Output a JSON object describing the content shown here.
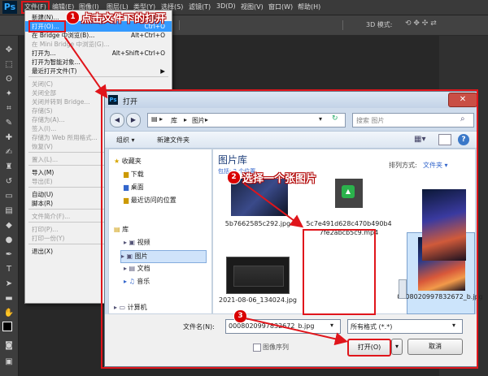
{
  "app": {
    "logo": "Ps"
  },
  "menubar": [
    "文件(F)",
    "编辑(E)",
    "图像(I)",
    "图层(L)",
    "类型(Y)",
    "选择(S)",
    "滤镜(T)",
    "3D(D)",
    "视图(V)",
    "窗口(W)",
    "帮助(H)"
  ],
  "options_bar": {
    "mode_3d": "3D 模式:"
  },
  "file_menu": {
    "items": [
      {
        "label": "新建(N)...",
        "shortcut": "Ctrl+N",
        "disabled": false
      },
      {
        "label": "打开(O)...",
        "shortcut": "Ctrl+O",
        "disabled": false,
        "highlight": true
      },
      {
        "label": "在 Bridge 中浏览(B)...",
        "shortcut": "Alt+Ctrl+O",
        "disabled": false
      },
      {
        "label": "在 Mini Bridge 中浏览(G)...",
        "shortcut": "",
        "disabled": true
      },
      {
        "label": "打开为...",
        "shortcut": "Alt+Shift+Ctrl+O",
        "disabled": false
      },
      {
        "label": "打开为智能对象...",
        "shortcut": "",
        "disabled": false
      },
      {
        "label": "最近打开文件(T)",
        "shortcut": "▶",
        "disabled": false
      },
      {
        "sep": true
      },
      {
        "label": "关闭(C)",
        "shortcut": "",
        "disabled": true
      },
      {
        "label": "关闭全部",
        "shortcut": "",
        "disabled": true
      },
      {
        "label": "关闭并转到 Bridge...",
        "shortcut": "",
        "disabled": true
      },
      {
        "label": "存储(S)",
        "shortcut": "",
        "disabled": true
      },
      {
        "label": "存储为(A)...",
        "shortcut": "",
        "disabled": true
      },
      {
        "label": "签入(I)...",
        "shortcut": "",
        "disabled": true
      },
      {
        "label": "存储为 Web 所用格式...",
        "shortcut": "",
        "disabled": true
      },
      {
        "label": "恢复(V)",
        "shortcut": "",
        "disabled": true
      },
      {
        "sep": true
      },
      {
        "label": "置入(L)...",
        "shortcut": "",
        "disabled": true
      },
      {
        "sep": true
      },
      {
        "label": "导入(M)",
        "shortcut": "",
        "disabled": false
      },
      {
        "label": "导出(E)",
        "shortcut": "",
        "disabled": true
      },
      {
        "sep": true
      },
      {
        "label": "自动(U)",
        "shortcut": "",
        "disabled": false
      },
      {
        "label": "脚本(R)",
        "shortcut": "",
        "disabled": false
      },
      {
        "sep": true
      },
      {
        "label": "文件简介(F)...",
        "shortcut": "",
        "disabled": true
      },
      {
        "sep": true
      },
      {
        "label": "打印(P)...",
        "shortcut": "",
        "disabled": true
      },
      {
        "label": "打印一份(Y)",
        "shortcut": "",
        "disabled": true
      },
      {
        "sep": true
      },
      {
        "label": "退出(X)",
        "shortcut": "",
        "disabled": false
      }
    ]
  },
  "dialog": {
    "title": "打开",
    "breadcrumb": [
      "库",
      "图片"
    ],
    "search_placeholder": "搜索 图片",
    "organize": "组织 ▾",
    "new_folder": "新建文件夹",
    "nav": {
      "favorites": "收藏夹",
      "downloads": "下载",
      "desktop": "桌面",
      "recent": "最近访问的位置",
      "libraries": "库",
      "videos": "视频",
      "pictures": "图片",
      "documents": "文档",
      "music": "音乐",
      "computer": "计算机"
    },
    "library_title": "图片库",
    "library_sub": "包括: 2 个位置",
    "arrange_label": "排列方式:",
    "arrange_value": "文件夹 ▾",
    "files": [
      {
        "name": "5b7662585c292.jpg"
      },
      {
        "name": "5c7e491d628c470b490b47fe2abcb5c9.mp4"
      },
      {
        "name": "2021-08-06_134024.jpg"
      },
      {
        "name": "0008020997832672_b.jpg"
      }
    ],
    "filename_label": "文件名(N):",
    "filename_value": "0008020997832672_b.jpg",
    "filter_value": "所有格式 (*.*)",
    "image_sequence": "图像序列",
    "open_button": "打开(O)",
    "cancel_button": "取消"
  },
  "annotations": {
    "step1": {
      "num": "1",
      "text": "点击文件下的打开"
    },
    "step2": {
      "num": "2",
      "text": "选择一个张图片"
    },
    "step3": {
      "num": "3"
    }
  },
  "colors": {
    "annotation": "#e0151b",
    "highlight": "#3399ff"
  }
}
